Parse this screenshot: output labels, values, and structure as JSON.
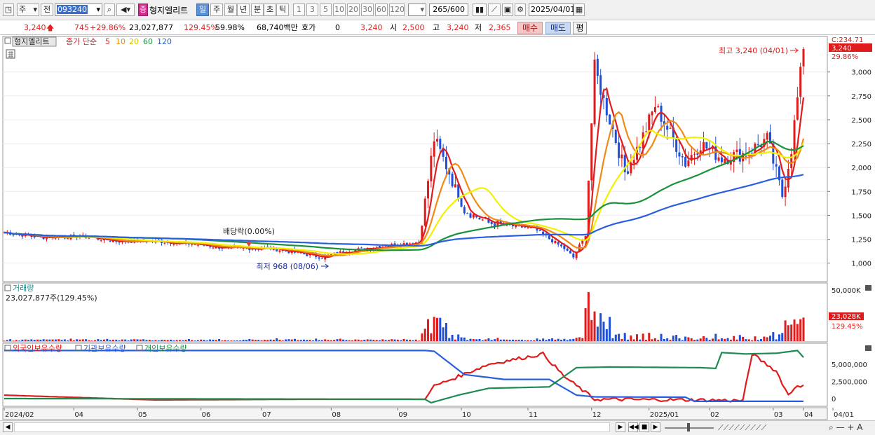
{
  "toolbar": {
    "type_select": "주",
    "prev_label": "전",
    "code": "093240",
    "stock_name": "형지엘리트",
    "stock_tag": "증",
    "periods": [
      "일",
      "주",
      "월",
      "년",
      "분",
      "초",
      "틱"
    ],
    "selected_period": "일",
    "intervals": [
      "1",
      "3",
      "5",
      "10",
      "20",
      "30",
      "60",
      "120"
    ],
    "count": "265",
    "count_total": "/600",
    "date": "2025/04/01"
  },
  "quote": {
    "price": "3,240",
    "change": "745",
    "change_pct": "+29.86%",
    "volume": "23,027,877",
    "volume_ratio": "129.45%",
    "turnover_ratio": "59.98%",
    "amount": "68,740백만",
    "hoga_label": "호가",
    "hoga_value": "0",
    "price2": "3,240",
    "open_label": "시",
    "open": "2,500",
    "high_label": "고",
    "high": "3,240",
    "low_label": "저",
    "low": "2,365",
    "buy_button": "매수",
    "sell_button": "매도",
    "eval_button": "평"
  },
  "legend": {
    "name": "형지엘리트",
    "ma_label": "종가 단순",
    "ma_periods": [
      "5",
      "10",
      "20",
      "60",
      "120"
    ],
    "ma_colors": [
      "#e11d1d",
      "#f08a16",
      "#f2f200",
      "#19923a",
      "#2a5ee0"
    ]
  },
  "annotations": {
    "high": "최고 3,240 (04/01)",
    "low": "최저 968 (08/06)",
    "dividend": "배당락(0.00%)",
    "last_price_tag": "3,240",
    "last_pct_tag": "29.86%",
    "axis_top_tag": "C:234.71"
  },
  "volume_panel": {
    "title": "거래량",
    "subtitle": "23,027,877주(129.45%)",
    "scale_label": "50,000K",
    "last_tag": "23,028K",
    "last_pct": "129.45%"
  },
  "holding_panel": {
    "legend": [
      "외국인보유수량",
      "기관보유수량",
      "개인보유수량"
    ],
    "legend_colors": [
      "#e01b1b",
      "#2a5ee0",
      "#1f8a52"
    ]
  },
  "chart_data": {
    "type": "candlestick",
    "price_axis": {
      "ticks": [
        1000,
        1250,
        1500,
        1750,
        2000,
        2250,
        2500,
        2750,
        3000
      ],
      "tick_labels": [
        "1,000",
        "1,250",
        "1,500",
        "1,750",
        "2,000",
        "2,250",
        "2,500",
        "2,750",
        "3,000"
      ],
      "range": [
        820,
        3360
      ]
    },
    "x_axis_labels": [
      "2024/02",
      "04",
      "05",
      "06",
      "07",
      "08",
      "09",
      "10",
      "11",
      "12",
      "2025/01",
      "02",
      "03",
      "04",
      "04/01"
    ],
    "price_anchors": [
      [
        0,
        1320
      ],
      [
        12,
        1270
      ],
      [
        25,
        1280
      ],
      [
        37,
        1230
      ],
      [
        50,
        1230
      ],
      [
        62,
        1200
      ],
      [
        75,
        1150
      ],
      [
        87,
        1160
      ],
      [
        100,
        1090
      ],
      [
        105,
        1060
      ],
      [
        112,
        1120
      ],
      [
        125,
        1180
      ],
      [
        137,
        1220
      ],
      [
        142,
        2300
      ],
      [
        147,
        1950
      ],
      [
        152,
        1550
      ],
      [
        160,
        1420
      ],
      [
        175,
        1360
      ],
      [
        185,
        1150
      ],
      [
        188,
        1060
      ],
      [
        192,
        1300
      ],
      [
        195,
        3050
      ],
      [
        198,
        2700
      ],
      [
        201,
        2400
      ],
      [
        205,
        1950
      ],
      [
        210,
        2250
      ],
      [
        215,
        2650
      ],
      [
        220,
        2350
      ],
      [
        225,
        2050
      ],
      [
        230,
        2250
      ],
      [
        237,
        2100
      ],
      [
        245,
        2150
      ],
      [
        252,
        2300
      ],
      [
        257,
        1700
      ],
      [
        260,
        2200
      ],
      [
        264,
        3240
      ]
    ],
    "volume_axis": {
      "ticks": [
        50000000
      ],
      "tick_labels": [
        "50,000K"
      ]
    },
    "volume_last": 23027877,
    "holding_axis": {
      "ticks": [
        0,
        2500000,
        5000000
      ],
      "tick_labels": [
        "0",
        "2,500,000",
        "5,000,000"
      ]
    },
    "holding_series": [
      {
        "name": "외국인보유수량",
        "anchors": [
          [
            0,
            500000
          ],
          [
            50,
            -200000
          ],
          [
            100,
            -100000
          ],
          [
            139,
            -100000
          ],
          [
            142,
            1800000
          ],
          [
            160,
            5000000
          ],
          [
            178,
            6500000
          ],
          [
            185,
            3200000
          ],
          [
            195,
            -100000
          ],
          [
            230,
            -200000
          ],
          [
            244,
            -300000
          ],
          [
            247,
            6500000
          ],
          [
            255,
            4000000
          ],
          [
            259,
            500000
          ],
          [
            262,
            2000000
          ],
          [
            264,
            1800000
          ]
        ]
      },
      {
        "name": "기관보유수량",
        "anchors": [
          [
            0,
            7000000
          ],
          [
            139,
            7000000
          ],
          [
            142,
            6900000
          ],
          [
            152,
            3500000
          ],
          [
            165,
            2800000
          ],
          [
            180,
            2800000
          ],
          [
            189,
            500000
          ],
          [
            195,
            250000
          ],
          [
            225,
            200000
          ],
          [
            228,
            -400000
          ],
          [
            264,
            -400000
          ]
        ]
      },
      {
        "name": "개인보유수량",
        "anchors": [
          [
            0,
            0
          ],
          [
            139,
            -100000
          ],
          [
            141,
            -600000
          ],
          [
            150,
            500000
          ],
          [
            160,
            1500000
          ],
          [
            180,
            1700000
          ],
          [
            189,
            4500000
          ],
          [
            200,
            4600000
          ],
          [
            230,
            4500000
          ],
          [
            235,
            4400000
          ],
          [
            237,
            6700000
          ],
          [
            245,
            6500000
          ],
          [
            255,
            6600000
          ],
          [
            262,
            7000000
          ],
          [
            264,
            6000000
          ]
        ]
      }
    ]
  }
}
